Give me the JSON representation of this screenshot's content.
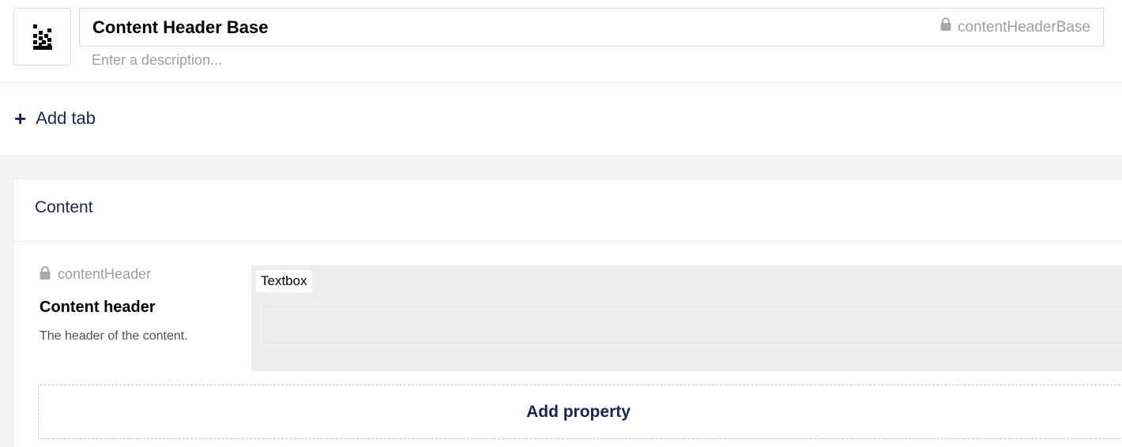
{
  "header": {
    "icon": "document-icon",
    "name_value": "Content Header Base",
    "alias": "contentHeaderBase",
    "description_placeholder": "Enter a description..."
  },
  "tabs": {
    "add_tab_label": "Add tab"
  },
  "group": {
    "title": "Content",
    "properties": [
      {
        "alias": "contentHeader",
        "label": "Content header",
        "description": "The header of the content.",
        "editor": "Textbox"
      }
    ],
    "add_property_label": "Add property"
  },
  "colors": {
    "accent": "#1b264f",
    "muted": "#9e9e9e",
    "canvas": "#f3f3f5",
    "editor_bg": "#ededee"
  }
}
